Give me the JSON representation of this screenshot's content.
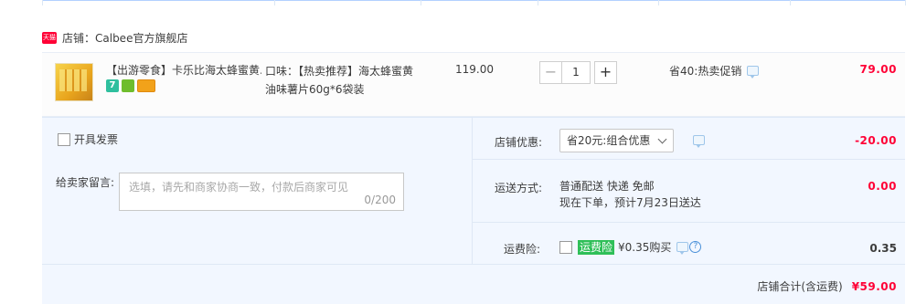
{
  "shop": {
    "icon_name": "tmall-icon",
    "icon_text": "天猫",
    "label": "店铺：Calbee官方旗舰店"
  },
  "item": {
    "title": "【出游零食】卡乐比海太蜂蜜黄...",
    "attr": "口味：【热卖推荐】海太蜂蜜黄油味薯片60g*6袋装",
    "badge_text": "7",
    "unit_price": "119.00",
    "quantity": "1",
    "minus": "−",
    "plus": "+",
    "promo": "省40:热卖促销",
    "total": "79.00"
  },
  "order": {
    "invoice_label": "开具发票",
    "message_label": "给卖家留言:",
    "message_placeholder": "选填，请先和商家协商一致，付款后商家可见",
    "message_counter": "0/200",
    "shop_discount_label": "店铺优惠:",
    "shop_discount_selected": "省20元:组合优惠",
    "shop_discount_value": "-20.00",
    "shipping_label": "运送方式:",
    "shipping_line1": "普通配送 快递 免邮",
    "shipping_line2": "现在下单，预计7月23日送达",
    "shipping_value": "0.00",
    "insurance_label": "运费险:",
    "insurance_tag": "运费险",
    "insurance_text": "¥0.35购买",
    "insurance_help": "?",
    "insurance_value": "0.35",
    "total_label": "店铺合计(含运费)",
    "total_value": "¥59.00"
  },
  "colors": {
    "price_red": "#ff0036",
    "panel_bg": "#f2f7ff",
    "insurance_green": "#2fbf58"
  }
}
